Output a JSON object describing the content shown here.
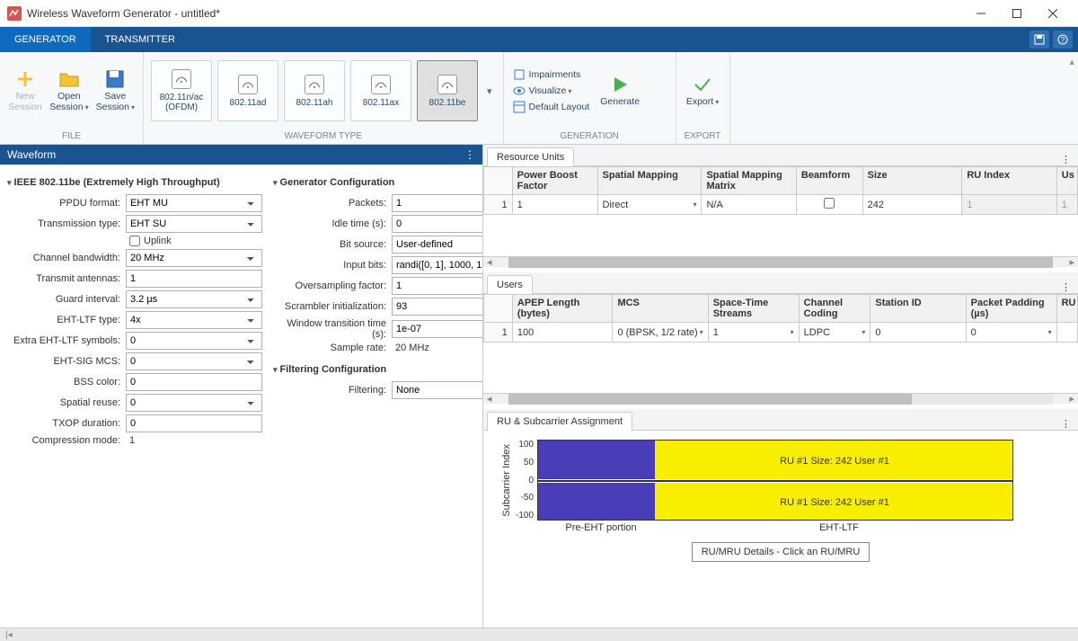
{
  "window": {
    "title": "Wireless Waveform Generator - untitled*"
  },
  "tabs": {
    "generator": "GENERATOR",
    "transmitter": "TRANSMITTER"
  },
  "ribbon": {
    "file": {
      "label": "FILE",
      "new_session": "New\nSession",
      "open_session": "Open\nSession",
      "save_session": "Save\nSession"
    },
    "waveform": {
      "label": "WAVEFORM TYPE",
      "items": [
        {
          "label": "802.11n/ac\n(OFDM)"
        },
        {
          "label": "802.11ad"
        },
        {
          "label": "802.11ah"
        },
        {
          "label": "802.11ax"
        },
        {
          "label": "802.11be",
          "selected": true
        }
      ]
    },
    "gen": {
      "label": "GENERATION",
      "impairments": "Impairments",
      "visualize": "Visualize",
      "default_layout": "Default Layout",
      "generate": "Generate"
    },
    "export": {
      "label": "EXPORT",
      "export": "Export"
    }
  },
  "waveform_panel": {
    "title": "Waveform",
    "section_ieee": "IEEE 802.11be (Extremely High Throughput)",
    "section_gen": "Generator Configuration",
    "section_filter": "Filtering Configuration",
    "fields": {
      "ppdu_format": {
        "label": "PPDU format:",
        "value": "EHT MU"
      },
      "transmission_type": {
        "label": "Transmission type:",
        "value": "EHT SU"
      },
      "uplink": {
        "label": "Uplink"
      },
      "channel_bw": {
        "label": "Channel bandwidth:",
        "value": "20 MHz"
      },
      "tx_antennas": {
        "label": "Transmit antennas:",
        "value": "1"
      },
      "guard_interval": {
        "label": "Guard interval:",
        "value": "3.2 µs"
      },
      "eht_ltf": {
        "label": "EHT-LTF type:",
        "value": "4x"
      },
      "extra_eht_ltf": {
        "label": "Extra EHT-LTF symbols:",
        "value": "0"
      },
      "eht_sig_mcs": {
        "label": "EHT-SIG MCS:",
        "value": "0"
      },
      "bss_color": {
        "label": "BSS color:",
        "value": "0"
      },
      "spatial_reuse": {
        "label": "Spatial reuse:",
        "value": "0"
      },
      "txop_duration": {
        "label": "TXOP duration:",
        "value": "0"
      },
      "compression_mode": {
        "label": "Compression mode:",
        "value": "1"
      },
      "packets": {
        "label": "Packets:",
        "value": "1"
      },
      "idle_time": {
        "label": "Idle time (s):",
        "value": "0"
      },
      "bit_source": {
        "label": "Bit source:",
        "value": "User-defined"
      },
      "input_bits": {
        "label": "Input bits:",
        "value": "randi([0, 1], 1000, 1"
      },
      "oversampling": {
        "label": "Oversampling factor:",
        "value": "1"
      },
      "scrambler": {
        "label": "Scrambler initialization:",
        "value": "93"
      },
      "window_transition": {
        "label": "Window transition time (s):",
        "value": "1e-07"
      },
      "sample_rate": {
        "label": "Sample rate:",
        "value": "20 MHz"
      },
      "filtering": {
        "label": "Filtering:",
        "value": "None"
      }
    }
  },
  "resource_units": {
    "title": "Resource Units",
    "headers": [
      "Power Boost Factor",
      "Spatial Mapping",
      "Spatial Mapping Matrix",
      "Beamform",
      "Size",
      "RU Index",
      "Us"
    ],
    "row": {
      "num": "1",
      "power_boost": "1",
      "spatial_mapping": "Direct",
      "matrix": "N/A",
      "beamform": false,
      "size": "242",
      "ru_index": "1",
      "us": "1"
    }
  },
  "users": {
    "title": "Users",
    "headers": [
      "APEP Length (bytes)",
      "MCS",
      "Space-Time Streams",
      "Channel Coding",
      "Station ID",
      "Packet Padding (µs)",
      "RU"
    ],
    "row": {
      "num": "1",
      "apep": "100",
      "mcs": "0 (BPSK, 1/2 rate)",
      "sts": "1",
      "coding": "LDPC",
      "station_id": "0",
      "padding": "0"
    }
  },
  "ru_assignment": {
    "title": "RU & Subcarrier Assignment",
    "ylabel": "Subcarrier Index",
    "yticks": [
      "100",
      "50",
      "0",
      "-50",
      "-100"
    ],
    "xlabels": [
      "Pre-EHT portion",
      "EHT-LTF"
    ],
    "ru_text": "RU #1   Size: 242   User #1",
    "detail_box": "RU/MRU Details - Click an RU/MRU"
  }
}
